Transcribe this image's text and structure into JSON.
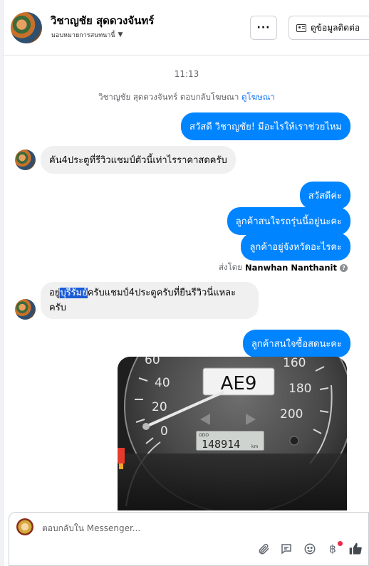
{
  "header": {
    "contact_name": "วิชาญชัย สุดดวงจันทร์",
    "assign_label": "มอบหมายการสนทนานี้",
    "more_label": "···",
    "contact_info_label": "ดูข้อมูลติดต่อ"
  },
  "thread": {
    "timestamp": "11:13",
    "reply_note_prefix": "วิชาญชัย สุดดวงจันทร์ ตอบกลับโฆษณา",
    "reply_note_link": "ดูโฆษณา",
    "messages": [
      {
        "dir": "out",
        "text": "สวัสดี วิชาญชัย! มีอะไรให้เราช่วยไหม"
      },
      {
        "dir": "in",
        "text": "คัน4ประตูที่รีวิวแชมป์ตัวนี้เท่าไรราคาสดครับ"
      },
      {
        "dir": "out",
        "text": "สวัสดีค่ะ"
      },
      {
        "dir": "out",
        "text": "ลูกค้าสนใจรถรุ่นนี้อยู่นะคะ"
      },
      {
        "dir": "out",
        "text": "ลูกค้าอยู่จังหวัดอะไรคะ"
      },
      {
        "dir": "in",
        "text_before": "อยู่",
        "text_highlight": "บุรีรัมย์",
        "text_after": "ครับแชมป์4ประตูครับที่ยืนรีวิวนี่แหละครับ"
      },
      {
        "dir": "out",
        "text": "ลูกค้าสนใจซื้อสดนะคะ"
      }
    ],
    "sent_by_prefix": "ส่งโดย",
    "sent_by_name": "Nanwhan Nanthanit",
    "photo": {
      "plate": "AE9",
      "odo_label": "ODO",
      "odometer": "148914",
      "odo_unit": "km",
      "speed_left": [
        "60",
        "40",
        "20",
        "0"
      ],
      "speed_right": [
        "160",
        "180",
        "200"
      ]
    }
  },
  "composer": {
    "placeholder": "ตอบกลับใน Messenger...",
    "icons": [
      "paperclip-icon",
      "quick-reply-icon",
      "emoji-icon",
      "payment-icon",
      "like-icon"
    ]
  }
}
